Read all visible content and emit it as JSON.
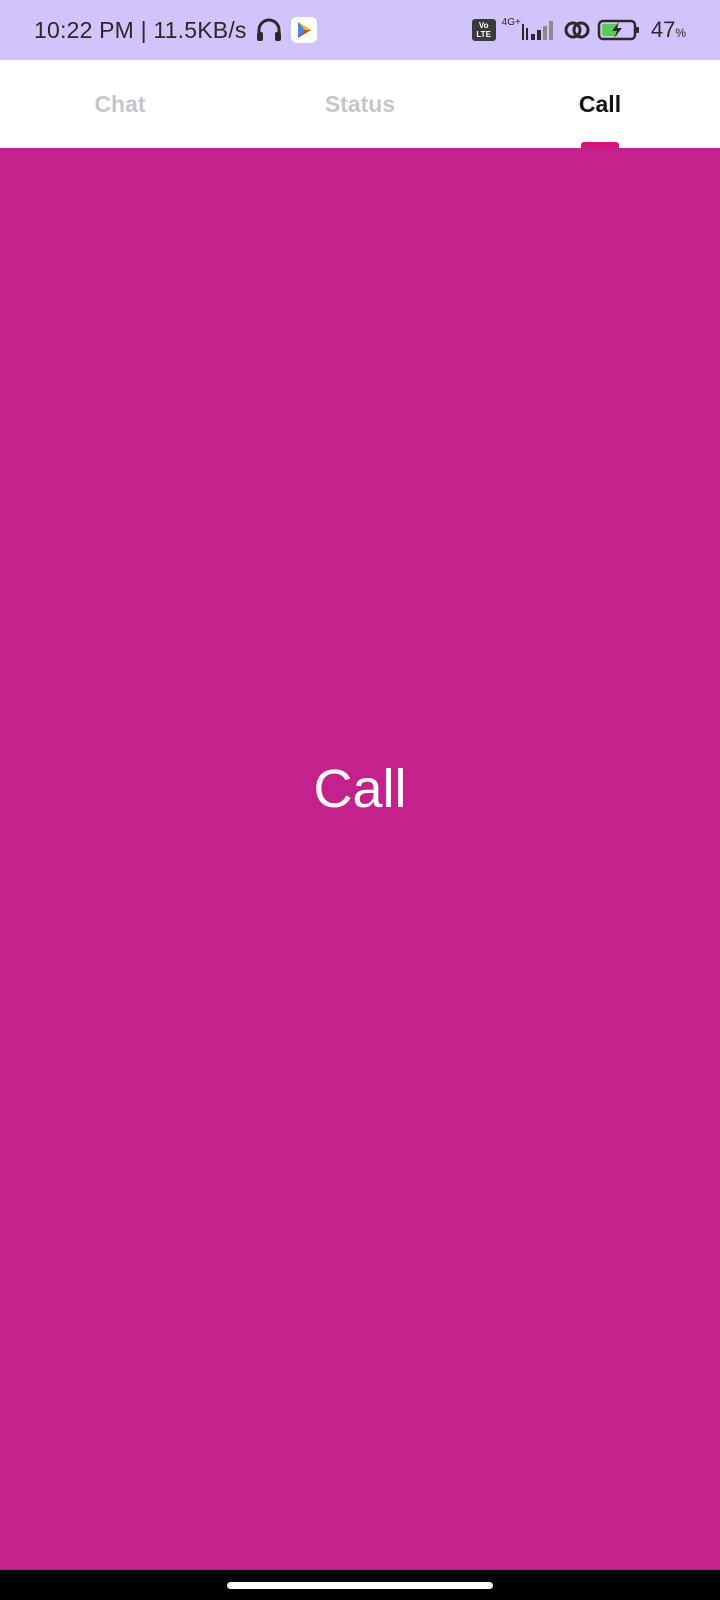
{
  "status_bar": {
    "time": "10:22 PM | 11.5KB/s",
    "volte_top": "Vo",
    "volte_bottom": "LTE",
    "network": "4G+",
    "battery_percent": "47",
    "battery_unit": "%",
    "icons": [
      "headphones-icon",
      "play-store-icon",
      "volte-icon",
      "signal-icon",
      "hotspot-icon",
      "battery-charging-icon"
    ]
  },
  "tabs": [
    {
      "label": "Chat",
      "active": false
    },
    {
      "label": "Status",
      "active": false
    },
    {
      "label": "Call",
      "active": true
    }
  ],
  "content": {
    "text": "Call",
    "background": "#C4218D"
  },
  "colors": {
    "status_bar_bg": "#D1C3FB",
    "accent": "#D6147E",
    "inactive_tab": "#c7c4cb"
  }
}
